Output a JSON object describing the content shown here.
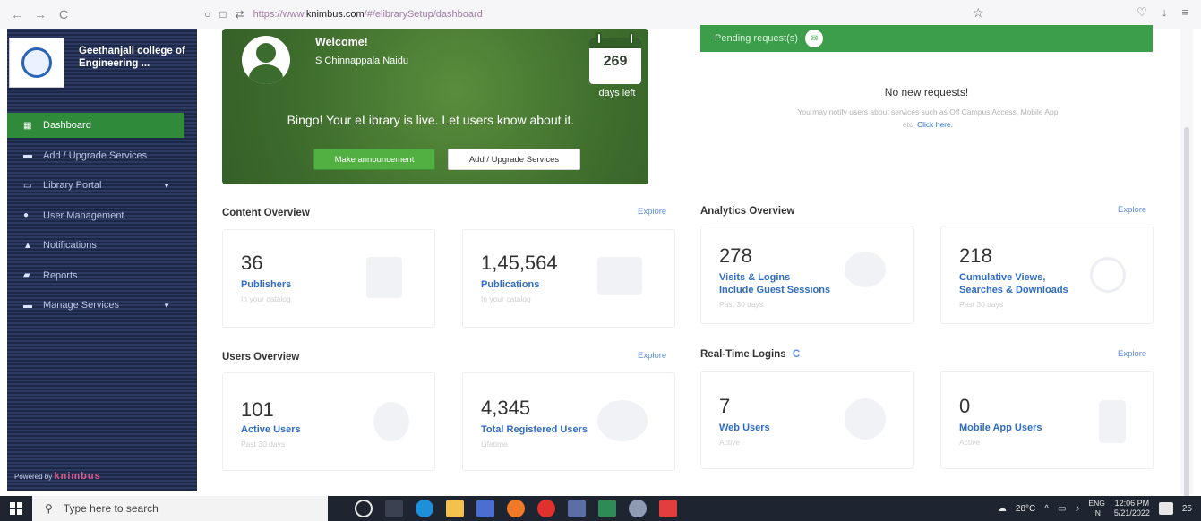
{
  "browser": {
    "url_prefix": "https://www.",
    "url_host": "knimbus.com",
    "url_rest": "/#/elibrarySetup/dashboard"
  },
  "sidebar": {
    "brand_name": "Geethanjali college of Engineering ...",
    "items": [
      {
        "label": "Dashboard",
        "icon": "dashboard-icon",
        "active": true
      },
      {
        "label": "Add / Upgrade Services",
        "icon": "cart-icon"
      },
      {
        "label": "Library Portal",
        "icon": "monitor-icon",
        "caret": true
      },
      {
        "label": "User Management",
        "icon": "user-icon"
      },
      {
        "label": "Notifications",
        "icon": "bell-icon"
      },
      {
        "label": "Reports",
        "icon": "chart-icon"
      },
      {
        "label": "Manage Services",
        "icon": "cart-icon",
        "caret": true
      }
    ],
    "powered_by": "Powered by",
    "powered_brand": "knimbus"
  },
  "welcome": {
    "title": "Welcome!",
    "user": "S Chinnappala Naidu",
    "days": "269",
    "days_left": "days left",
    "message": "Bingo! Your eLibrary is live. Let users know about it.",
    "announce_button": "Make announcement",
    "upgrade_button": "Add / Upgrade Services"
  },
  "pending": {
    "title": "Pending request(s)",
    "no_requests": "No new requests!",
    "note": "You may notify users about services such as Off Campus Access, Mobile App etc.",
    "link": "Click here."
  },
  "content_overview": {
    "title": "Content Overview",
    "explore": "Explore",
    "cards": [
      {
        "value": "36",
        "label": "Publishers",
        "sub": "In your catalog"
      },
      {
        "value": "1,45,564",
        "label": "Publications",
        "sub": "In your catalog"
      }
    ]
  },
  "analytics_overview": {
    "title": "Analytics Overview",
    "explore": "Explore",
    "cards": [
      {
        "value": "278",
        "label": "Visits & Logins",
        "label2": "Include Guest Sessions",
        "sub": "Past 30 days"
      },
      {
        "value": "218",
        "label": "Cumulative Views,",
        "label2": "Searches & Downloads",
        "sub": "Past 30 days"
      }
    ]
  },
  "users_overview": {
    "title": "Users Overview",
    "explore": "Explore",
    "cards": [
      {
        "value": "101",
        "label": "Active Users",
        "sub": "Past 30 days"
      },
      {
        "value": "4,345",
        "label": "Total Registered Users",
        "sub": "Lifetime"
      }
    ]
  },
  "realtime": {
    "title": "Real-Time Logins",
    "explore": "Explore",
    "cards": [
      {
        "value": "7",
        "label": "Web Users",
        "sub": "Active"
      },
      {
        "value": "0",
        "label": "Mobile App Users",
        "sub": "Active"
      }
    ]
  },
  "taskbar": {
    "search_placeholder": "Type here to search",
    "weather": "28°C",
    "lang": "ENG",
    "lang2": "IN",
    "time": "12:06 PM",
    "date": "5/21/2022",
    "badge": "25"
  }
}
